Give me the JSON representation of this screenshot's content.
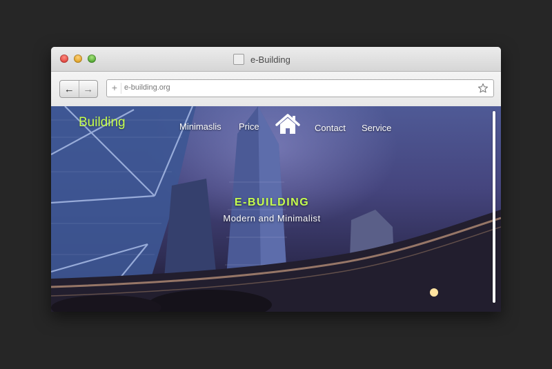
{
  "window": {
    "title": "e-Building",
    "tab_icon": "page-icon"
  },
  "toolbar": {
    "back_icon": "arrow-left-icon",
    "forward_icon": "arrow-right-icon",
    "url_plus": "+",
    "url": "e-building.org",
    "bookmark_icon": "star-icon"
  },
  "site": {
    "logo": "Building",
    "nav": [
      "Minimaslis",
      "Price",
      "Contact",
      "Service"
    ],
    "home_icon": "home-icon",
    "hero_title": "E-BUILDING",
    "hero_subtitle": "Modern and Minimalist"
  },
  "colors": {
    "background": "#262626",
    "accent": "#c6ff4e"
  }
}
